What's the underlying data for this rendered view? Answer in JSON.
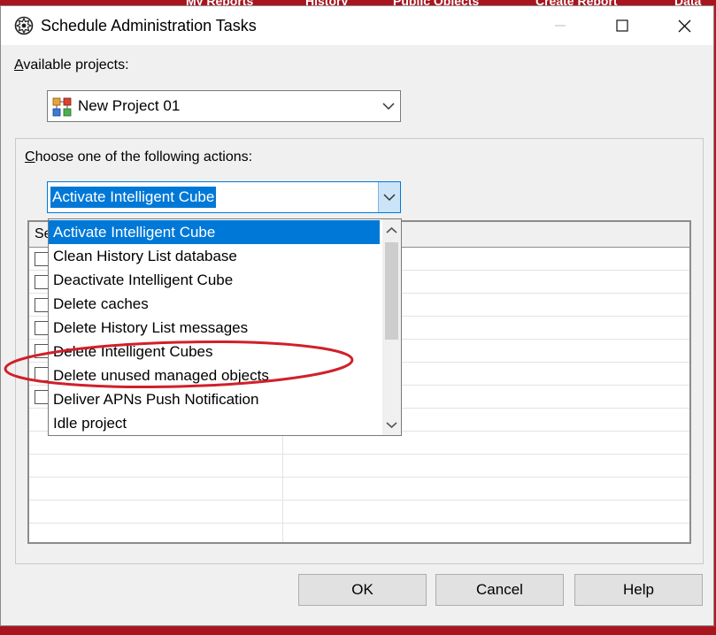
{
  "background": {
    "tabs": [
      "My Reports",
      "History",
      "Public Objects",
      "Create Report",
      "Data"
    ]
  },
  "dialog": {
    "title": "Schedule Administration Tasks"
  },
  "projects": {
    "label": "Available projects:",
    "label_access_key": "A",
    "label_rest": "vailable projects:",
    "selected": "New Project 01"
  },
  "actions": {
    "label_access_key": "C",
    "label_rest": "hoose one of the following actions:",
    "selected": "Activate Intelligent Cube",
    "options": [
      "Activate Intelligent Cube",
      "Clean History List database",
      "Deactivate Intelligent Cube",
      "Delete caches",
      "Delete History List messages",
      "Delete Intelligent Cubes",
      "Delete unused managed objects",
      "Deliver APNs Push Notification",
      "Idle project"
    ],
    "highlighted_index": 0,
    "annotated_option": "Delete unused managed objects"
  },
  "grid": {
    "header_first": "Se",
    "row_count": 12
  },
  "buttons": {
    "ok": "OK",
    "cancel": "Cancel",
    "help": "Help"
  },
  "colors": {
    "selection": "#0078d7",
    "annotation_ellipse": "#d0202a",
    "background_app": "#b01a24"
  },
  "icons": {
    "app": "schedule-gear-icon",
    "project": "project-icon"
  }
}
